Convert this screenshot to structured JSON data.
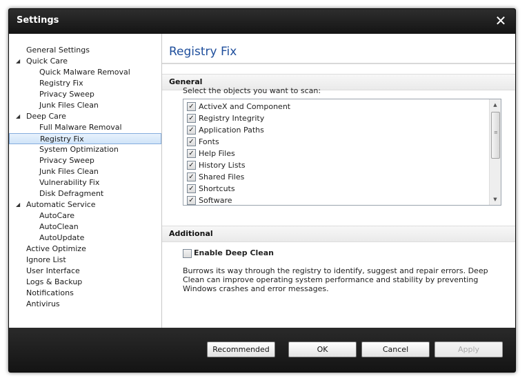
{
  "window": {
    "title": "Settings",
    "close_glyph": "✕"
  },
  "sidebar": {
    "items": [
      {
        "label": "General Settings",
        "level": 0
      },
      {
        "label": "Quick Care",
        "level": 0,
        "expander": "◢"
      },
      {
        "label": "Quick Malware Removal",
        "level": 1
      },
      {
        "label": "Registry Fix",
        "level": 1
      },
      {
        "label": "Privacy Sweep",
        "level": 1
      },
      {
        "label": "Junk Files Clean",
        "level": 1
      },
      {
        "label": "Deep Care",
        "level": 0,
        "expander": "◢"
      },
      {
        "label": "Full Malware Removal",
        "level": 1
      },
      {
        "label": "Registry Fix",
        "level": 1,
        "selected": true
      },
      {
        "label": "System Optimization",
        "level": 1
      },
      {
        "label": "Privacy Sweep",
        "level": 1
      },
      {
        "label": "Junk Files Clean",
        "level": 1
      },
      {
        "label": "Vulnerability Fix",
        "level": 1
      },
      {
        "label": "Disk Defragment",
        "level": 1
      },
      {
        "label": "Automatic Service",
        "level": 0,
        "expander": "◢"
      },
      {
        "label": "AutoCare",
        "level": 1
      },
      {
        "label": "AutoClean",
        "level": 1
      },
      {
        "label": "AutoUpdate",
        "level": 1
      },
      {
        "label": "Active Optimize",
        "level": 0
      },
      {
        "label": "Ignore List",
        "level": 0
      },
      {
        "label": "User Interface",
        "level": 0
      },
      {
        "label": "Logs & Backup",
        "level": 0
      },
      {
        "label": "Notifications",
        "level": 0
      },
      {
        "label": "Antivirus",
        "level": 0
      }
    ]
  },
  "main": {
    "page_title": "Registry Fix",
    "general": {
      "heading": "General",
      "hint": "Select the objects you want to scan:",
      "objects": [
        {
          "label": "ActiveX and Component",
          "checked": true
        },
        {
          "label": "Registry Integrity",
          "checked": true
        },
        {
          "label": "Application Paths",
          "checked": true
        },
        {
          "label": "Fonts",
          "checked": true
        },
        {
          "label": "Help Files",
          "checked": true
        },
        {
          "label": "History Lists",
          "checked": true
        },
        {
          "label": "Shared Files",
          "checked": true
        },
        {
          "label": "Shortcuts",
          "checked": true
        },
        {
          "label": "Software",
          "checked": true
        }
      ]
    },
    "additional": {
      "heading": "Additional",
      "deep_clean_label": "Enable Deep Clean",
      "deep_clean_checked": false,
      "description": "Burrows its way through the registry to identify, suggest and repair errors. Deep Clean can improve operating system performance and stability by preventing Windows crashes and error messages."
    }
  },
  "footer": {
    "recommended": "Recommended",
    "ok": "OK",
    "cancel": "Cancel",
    "apply": "Apply"
  },
  "colors": {
    "title_blue": "#1e4e9c",
    "selection_border": "#84acdd"
  }
}
